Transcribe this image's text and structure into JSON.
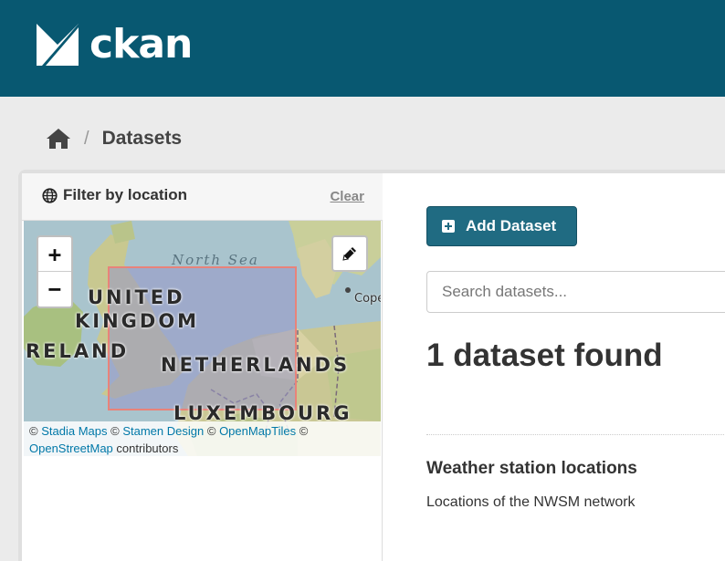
{
  "header": {
    "brand": "ckan",
    "logo_icon": "ckan-logo-icon",
    "color": "#085871"
  },
  "breadcrumb": {
    "home_icon": "home-icon",
    "separator": "/",
    "current": "Datasets"
  },
  "sidebar": {
    "filter_title": "Filter by location",
    "clear_label": "Clear",
    "map": {
      "sea_label": "North Sea",
      "labels": [
        "UNITED",
        "KINGDOM",
        "RELAND",
        "NETHERLANDS",
        "LUXEMBOURG"
      ],
      "city": "Cope",
      "zoom_in": "+",
      "zoom_out": "−",
      "draw_icon": "pencil-icon",
      "attribution": {
        "stadia": "Stadia Maps",
        "stamen": "Stamen Design",
        "openmaptiles": "OpenMapTiles",
        "osm": "OpenStreetMap",
        "contributors": "contributors",
        "copyright": "©"
      }
    }
  },
  "main": {
    "add_button": "Add Dataset",
    "search_placeholder": "Search datasets...",
    "found_text": "1 dataset found",
    "datasets": [
      {
        "title": "Weather station locations",
        "description": "Locations of the NWSM network"
      }
    ]
  }
}
